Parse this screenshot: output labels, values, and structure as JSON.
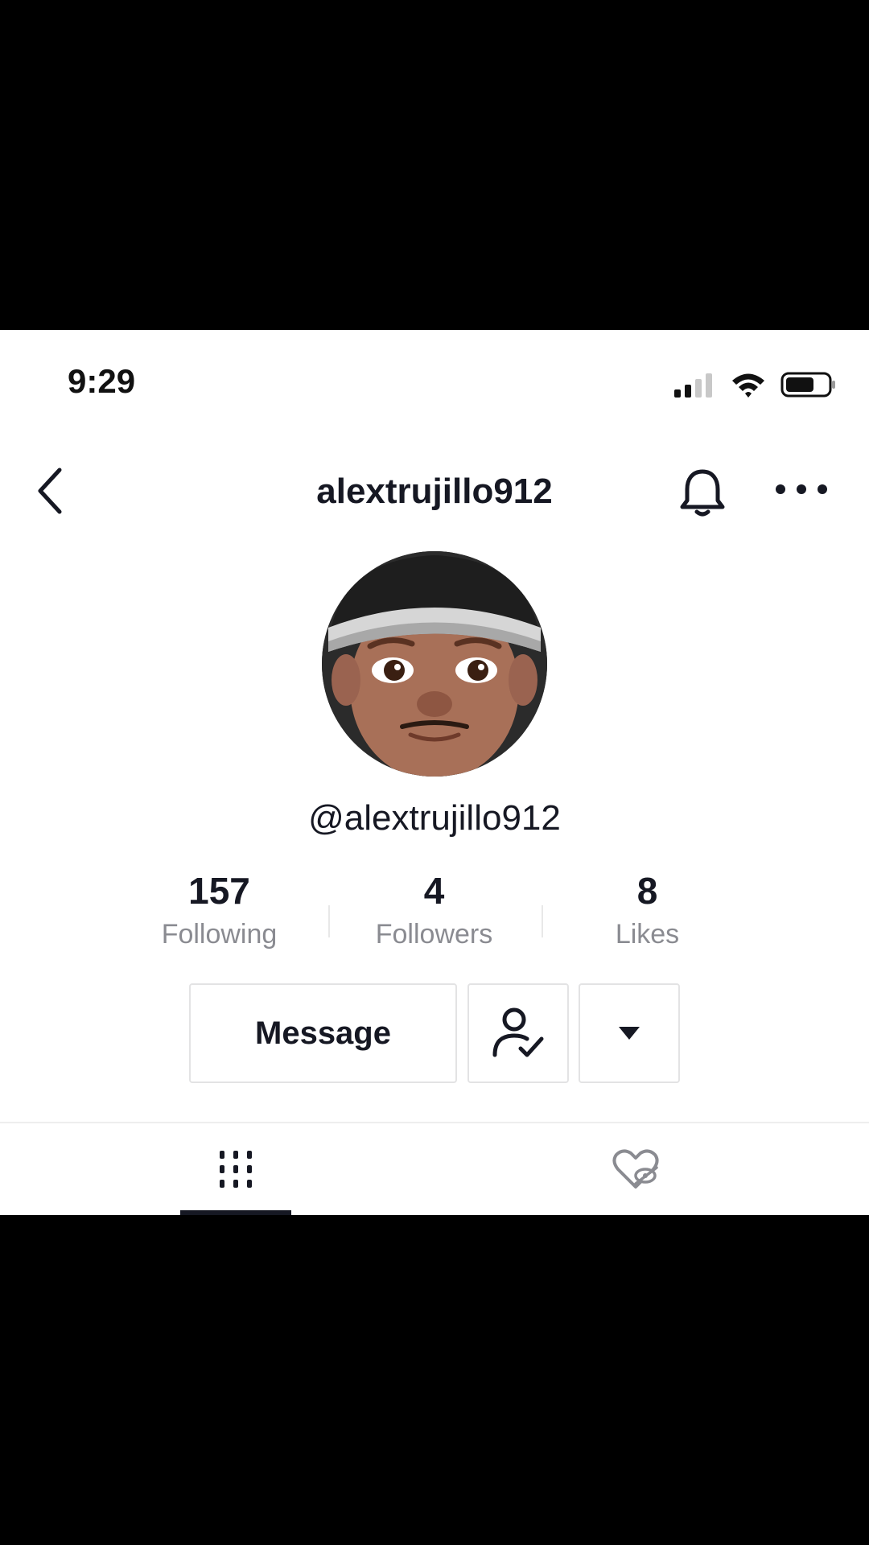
{
  "status_bar": {
    "time": "9:29",
    "icons": [
      "signal-icon",
      "wifi-icon",
      "battery-icon"
    ]
  },
  "header": {
    "title": "alextrujillo912",
    "icons": [
      "back-chevron-icon",
      "bell-icon",
      "more-dots-icon"
    ]
  },
  "profile": {
    "handle": "@alextrujillo912",
    "stats": [
      {
        "value": "157",
        "label": "Following"
      },
      {
        "value": "4",
        "label": "Followers"
      },
      {
        "value": "8",
        "label": "Likes"
      }
    ]
  },
  "actions": {
    "message_label": "Message",
    "follow_icon": "user-check-icon",
    "dropdown_icon": "caret-down-icon"
  },
  "tabs": {
    "items": [
      "videos-grid-icon",
      "liked-hidden-icon"
    ],
    "active": 0
  },
  "colors": {
    "text": "#161823",
    "muted": "#8a8b91",
    "border": "#e3e3e4"
  }
}
